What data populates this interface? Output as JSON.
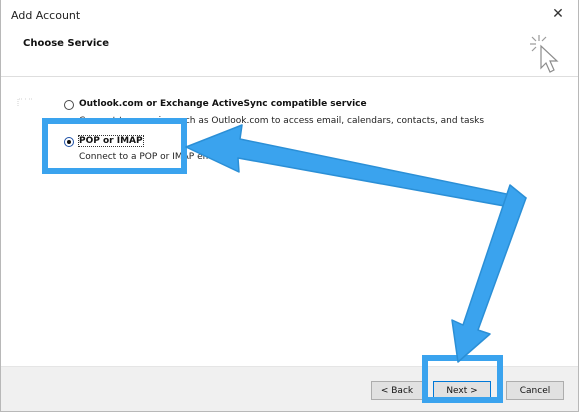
{
  "window": {
    "title": "Add Account",
    "close_glyph": "✕"
  },
  "header": {
    "section_title": "Choose Service",
    "icon": "cursor-click-icon"
  },
  "options": {
    "outlook": {
      "label": "Outlook.com or Exchange ActiveSync compatible service",
      "description": "Connect to a service such as Outlook.com to access email, calendars, contacts, and tasks",
      "selected": false
    },
    "pop_imap": {
      "label": "POP or IMAP",
      "description": "Connect to a POP or IMAP email account",
      "selected": true
    }
  },
  "buttons": {
    "back": "< Back",
    "next": "Next >",
    "cancel": "Cancel"
  },
  "annotations": {
    "highlight_color": "#3aa3ee",
    "arrow_color": "#3aa3ee"
  }
}
